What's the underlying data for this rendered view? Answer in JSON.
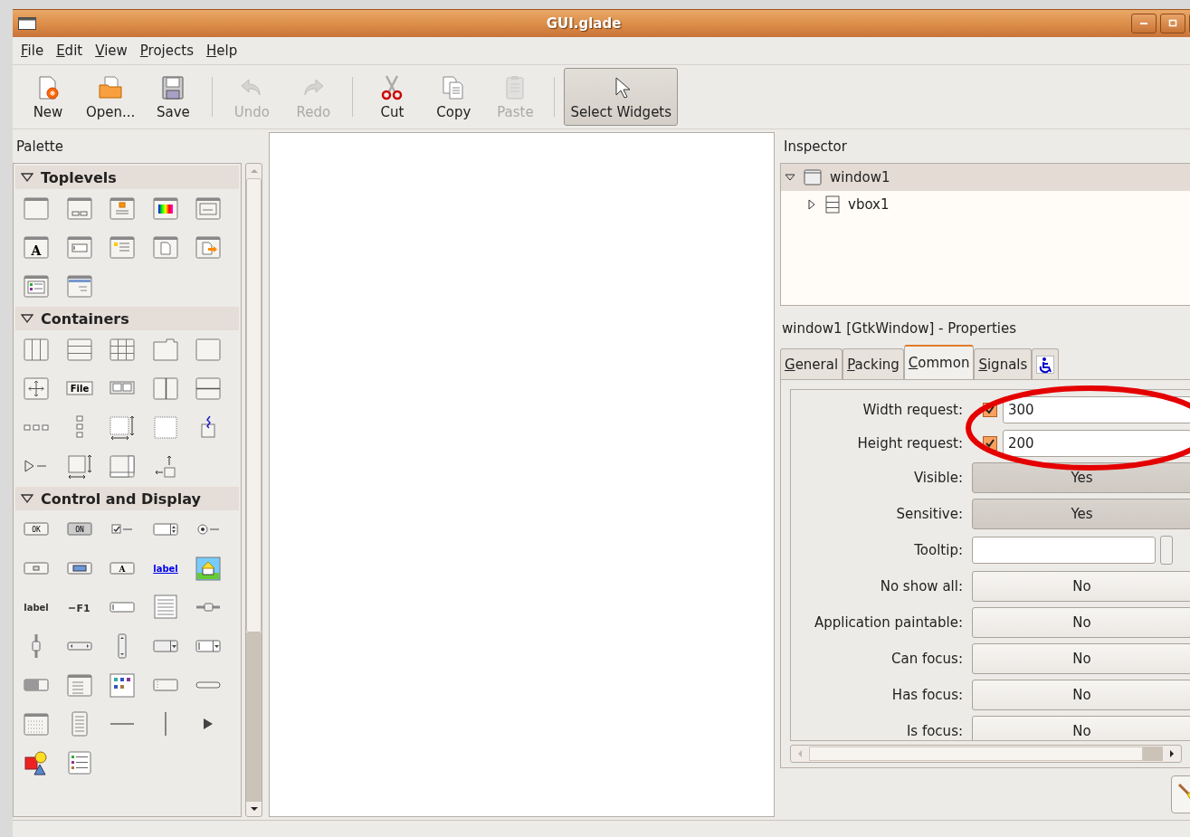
{
  "window": {
    "title": "GUI.glade"
  },
  "menu": [
    {
      "label": "File"
    },
    {
      "label": "Edit"
    },
    {
      "label": "View"
    },
    {
      "label": "Projects"
    },
    {
      "label": "Help"
    }
  ],
  "toolbar": [
    {
      "kind": "new",
      "label": "New",
      "disabled": false,
      "selected": false
    },
    {
      "kind": "open",
      "label": "Open...",
      "disabled": false,
      "selected": false
    },
    {
      "kind": "save",
      "label": "Save",
      "disabled": false,
      "selected": false
    },
    {
      "kind": "separator"
    },
    {
      "kind": "undo",
      "label": "Undo",
      "disabled": true,
      "selected": false
    },
    {
      "kind": "redo",
      "label": "Redo",
      "disabled": true,
      "selected": false
    },
    {
      "kind": "separator"
    },
    {
      "kind": "cut",
      "label": "Cut",
      "disabled": false,
      "selected": false
    },
    {
      "kind": "copy",
      "label": "Copy",
      "disabled": false,
      "selected": false
    },
    {
      "kind": "paste",
      "label": "Paste",
      "disabled": true,
      "selected": false
    },
    {
      "kind": "separator"
    },
    {
      "kind": "pointer",
      "label": "Select Widgets",
      "disabled": false,
      "selected": true
    }
  ],
  "palette": {
    "title": "Palette",
    "groups": [
      {
        "label": "Toplevels",
        "expanded": true,
        "items": [
          {
            "kind": "window"
          },
          {
            "kind": "dialog-window"
          },
          {
            "kind": "about-window"
          },
          {
            "kind": "color-window"
          },
          {
            "kind": "form-window"
          },
          {
            "kind": "font-window",
            "glyph": "A"
          },
          {
            "kind": "entry-window"
          },
          {
            "kind": "message-window"
          },
          {
            "kind": "page-window"
          },
          {
            "kind": "export-window"
          },
          {
            "kind": "list-window"
          },
          {
            "kind": "bar-window"
          }
        ]
      },
      {
        "label": "Containers",
        "expanded": true,
        "items": [
          {
            "kind": "column-box"
          },
          {
            "kind": "row-box"
          },
          {
            "kind": "table-grid"
          },
          {
            "kind": "notebook"
          },
          {
            "kind": "frame-box"
          },
          {
            "kind": "move-arrows"
          },
          {
            "kind": "menu-bar",
            "glyph": "File"
          },
          {
            "kind": "toolbar-box"
          },
          {
            "kind": "split-columns"
          },
          {
            "kind": "split-rows"
          },
          {
            "kind": "button-row"
          },
          {
            "kind": "button-column"
          },
          {
            "kind": "viewport"
          },
          {
            "kind": "dotted-layout"
          },
          {
            "kind": "event-box"
          },
          {
            "kind": "expander"
          },
          {
            "kind": "alignment"
          },
          {
            "kind": "scrolled-box"
          },
          {
            "kind": "handle-box"
          }
        ]
      },
      {
        "label": "Control and Display",
        "expanded": true,
        "items": [
          {
            "kind": "push-button",
            "glyph": "OK"
          },
          {
            "kind": "toggle-button",
            "glyph": "ON"
          },
          {
            "kind": "check-box"
          },
          {
            "kind": "spin-box"
          },
          {
            "kind": "radio-button"
          },
          {
            "kind": "file-button"
          },
          {
            "kind": "color-button"
          },
          {
            "kind": "font-button",
            "glyph": "A"
          },
          {
            "kind": "link",
            "glyph": "label"
          },
          {
            "kind": "image"
          },
          {
            "kind": "text-label",
            "glyph": "label"
          },
          {
            "kind": "accel-label",
            "glyph": "F1"
          },
          {
            "kind": "entry-field"
          },
          {
            "kind": "text-view"
          },
          {
            "kind": "horizontal-slider"
          },
          {
            "kind": "vertical-slider"
          },
          {
            "kind": "horizontal-scrollbar"
          },
          {
            "kind": "vertical-scrollbar"
          },
          {
            "kind": "combo-box"
          },
          {
            "kind": "combo-entry"
          },
          {
            "kind": "progress-bar"
          },
          {
            "kind": "tree-view"
          },
          {
            "kind": "icon-view"
          },
          {
            "kind": "status-bar"
          },
          {
            "kind": "slim-bar"
          },
          {
            "kind": "calendar"
          },
          {
            "kind": "text-page"
          },
          {
            "kind": "horizontal-line"
          },
          {
            "kind": "vertical-line"
          },
          {
            "kind": "arrow"
          },
          {
            "kind": "shapes"
          },
          {
            "kind": "list-items"
          }
        ]
      }
    ]
  },
  "inspector": {
    "title": "Inspector",
    "tree": [
      {
        "label": "window1",
        "kind": "window",
        "expanded": true,
        "selected": true,
        "children": [
          {
            "label": "vbox1",
            "kind": "vbox",
            "expanded": false,
            "selected": false
          }
        ]
      }
    ]
  },
  "properties": {
    "title": "window1 [GtkWindow] - Properties",
    "tabs": [
      {
        "label": "General",
        "kind": "text",
        "selected": false
      },
      {
        "label": "Packing",
        "kind": "text",
        "selected": false
      },
      {
        "label": "Common",
        "kind": "text",
        "selected": true
      },
      {
        "label": "Signals",
        "kind": "text",
        "selected": false
      },
      {
        "kind": "accessibility",
        "selected": false
      }
    ],
    "rows": [
      {
        "label": "Width request:",
        "kind": "spin",
        "checked": true,
        "value": "300"
      },
      {
        "label": "Height request:",
        "kind": "spin",
        "checked": true,
        "value": "200"
      },
      {
        "label": "Visible:",
        "kind": "toggle",
        "on": true,
        "value": "Yes"
      },
      {
        "label": "Sensitive:",
        "kind": "toggle",
        "on": true,
        "value": "Yes"
      },
      {
        "label": "Tooltip:",
        "kind": "text"
      },
      {
        "label": "No show all:",
        "kind": "toggle",
        "on": false,
        "value": "No"
      },
      {
        "label": "Application paintable:",
        "kind": "toggle",
        "on": false,
        "value": "No"
      },
      {
        "label": "Can focus:",
        "kind": "toggle",
        "on": false,
        "value": "No"
      },
      {
        "label": "Has focus:",
        "kind": "toggle",
        "on": false,
        "value": "No"
      },
      {
        "label": "Is focus:",
        "kind": "toggle",
        "on": false,
        "value": "No"
      }
    ]
  }
}
